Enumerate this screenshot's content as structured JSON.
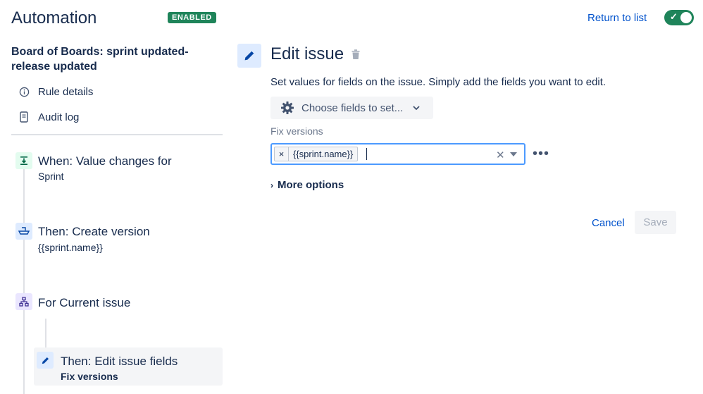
{
  "header": {
    "title": "Automation",
    "status_badge": "ENABLED",
    "return_link": "Return to list",
    "toggle_on": true
  },
  "sidebar": {
    "rule_name": "Board of Boards: sprint updated-release updated",
    "links": [
      {
        "label": "Rule details",
        "icon": "info-icon"
      },
      {
        "label": "Audit log",
        "icon": "document-icon"
      }
    ],
    "steps": [
      {
        "title": "When: Value changes for",
        "subtitle": "Sprint",
        "icon": "trigger-icon",
        "color": "#E3FCEF"
      },
      {
        "title": "Then: Create version",
        "subtitle": "{{sprint.name}}",
        "icon": "ship-icon",
        "color": "#DEEBFF"
      },
      {
        "title": "For Current issue",
        "subtitle": "",
        "icon": "branch-icon",
        "color": "#EAE6FF"
      },
      {
        "title": "Then: Edit issue fields",
        "subtitle": "Fix versions",
        "icon": "pencil-icon",
        "color": "#DEEBFF"
      }
    ]
  },
  "main": {
    "title": "Edit issue",
    "description": "Set values for fields on the issue. Simply add the fields you want to edit.",
    "choose_fields_label": "Choose fields to set...",
    "field_label": "Fix versions",
    "field_values": [
      "{{sprint.name}}"
    ],
    "more_options_label": "More options",
    "cancel_label": "Cancel",
    "save_label": "Save"
  },
  "colors": {
    "accent": "#0052CC",
    "enabled": "#1F845A",
    "focus_border": "#4C9AFF"
  }
}
